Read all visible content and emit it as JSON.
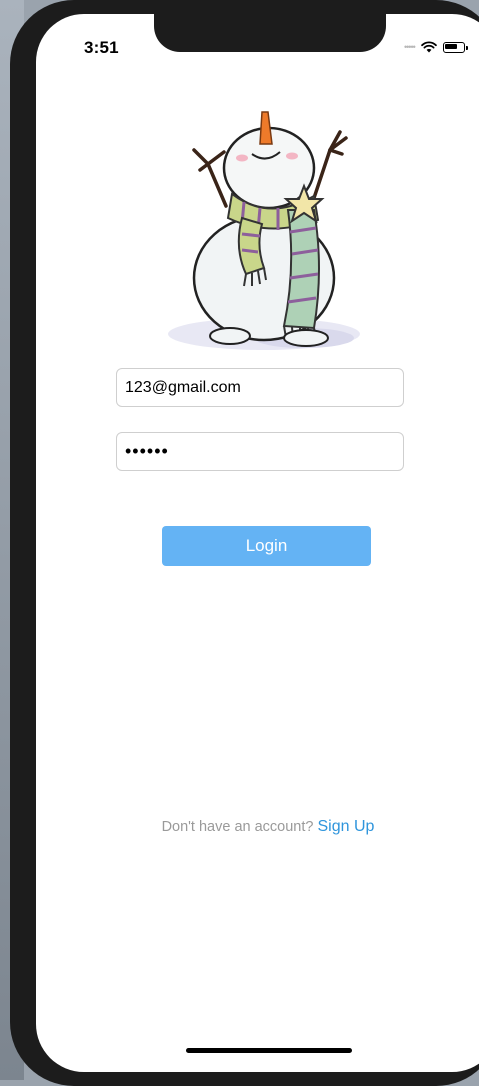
{
  "status_bar": {
    "time": "3:51",
    "signal_icon": "signal-dots-icon",
    "wifi_icon": "wifi-icon",
    "battery_icon": "battery-icon"
  },
  "logo": {
    "icon": "snowman-logo"
  },
  "form": {
    "email_value": "123@gmail.com",
    "password_value": "••••••"
  },
  "login_button": {
    "label": "Login",
    "color": "#64b3f4"
  },
  "signup": {
    "prompt": "Don't have an account?",
    "link": "Sign Up",
    "link_color": "#2f95dc"
  }
}
